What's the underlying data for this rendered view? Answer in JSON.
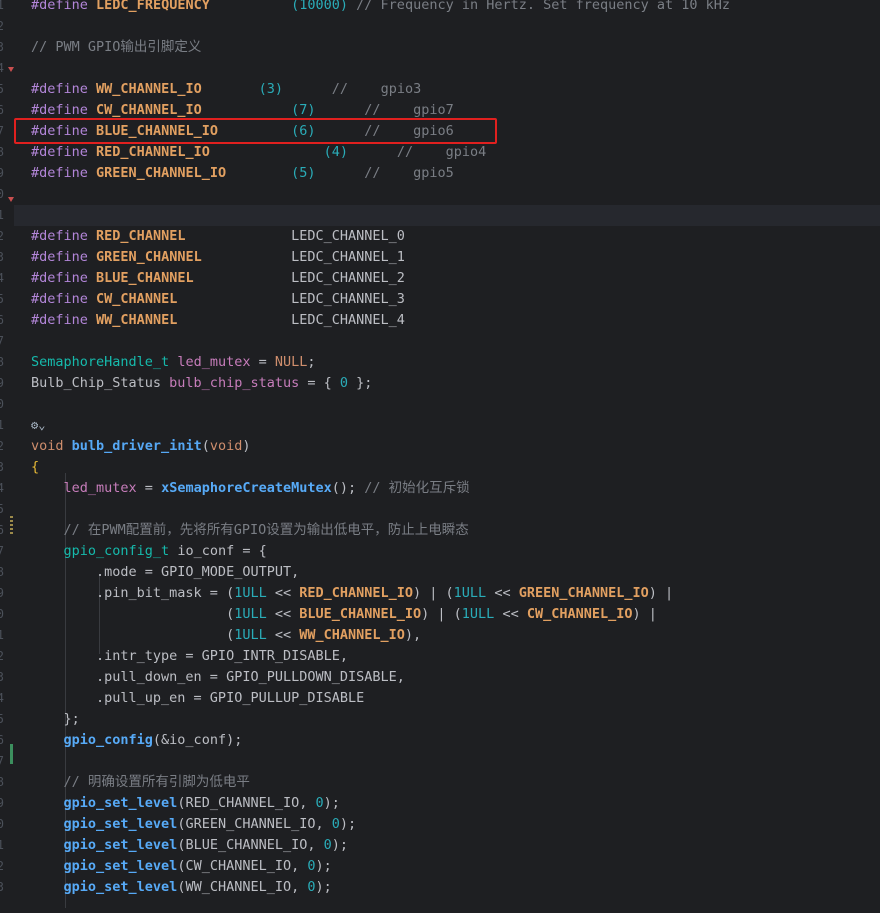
{
  "editor": {
    "gutter_numbers": [
      "",
      "1",
      "2",
      "3",
      "4",
      "5",
      "6",
      "7",
      "8",
      "9",
      "0",
      "1",
      "2",
      "3",
      "4",
      "5",
      "6",
      "7",
      "8",
      "9",
      "0",
      "1",
      "2",
      "3",
      "4",
      "5",
      "6",
      "7",
      "8",
      "9",
      "0",
      "1",
      "2",
      "3",
      "4",
      "5",
      "6",
      "7",
      "8",
      "9",
      "0",
      "1",
      "2",
      "3"
    ],
    "lines": [
      {
        "tokens": [
          [
            "pp",
            "#define"
          ],
          [
            "pl",
            " "
          ],
          [
            "mc",
            "LEDC_FREQUENCY"
          ],
          [
            "pl",
            "          "
          ],
          [
            "num",
            "(10000)"
          ],
          [
            "pl",
            " "
          ],
          [
            "cm",
            "// Frequency in Hertz. Set frequency at 10 kHz"
          ]
        ]
      },
      {
        "tokens": []
      },
      {
        "tokens": [
          [
            "cm",
            "// PWM GPIO输出引脚定义"
          ]
        ]
      },
      {
        "tokens": []
      },
      {
        "tokens": [
          [
            "pp",
            "#define"
          ],
          [
            "pl",
            " "
          ],
          [
            "mc",
            "WW_CHANNEL_IO"
          ],
          [
            "pl",
            "       "
          ],
          [
            "num",
            "(3)"
          ],
          [
            "pl",
            "      "
          ],
          [
            "cm",
            "//    gpio3"
          ]
        ]
      },
      {
        "tokens": [
          [
            "pp",
            "#define"
          ],
          [
            "pl",
            " "
          ],
          [
            "mc",
            "CW_CHANNEL_IO"
          ],
          [
            "pl",
            "           "
          ],
          [
            "num",
            "(7)"
          ],
          [
            "pl",
            "      "
          ],
          [
            "cm",
            "//    gpio7"
          ]
        ]
      },
      {
        "tokens": [
          [
            "pp",
            "#define"
          ],
          [
            "pl",
            " "
          ],
          [
            "mc",
            "BLUE_CHANNEL_IO"
          ],
          [
            "pl",
            "         "
          ],
          [
            "num",
            "(6)"
          ],
          [
            "pl",
            "      "
          ],
          [
            "cm",
            "//    gpio6"
          ]
        ]
      },
      {
        "tokens": [
          [
            "pp",
            "#define"
          ],
          [
            "pl",
            " "
          ],
          [
            "mc",
            "RED_CHANNEL_IO"
          ],
          [
            "pl",
            "              "
          ],
          [
            "num",
            "(4)"
          ],
          [
            "pl",
            "      "
          ],
          [
            "cm",
            "//    gpio4"
          ]
        ]
      },
      {
        "tokens": [
          [
            "pp",
            "#define"
          ],
          [
            "pl",
            " "
          ],
          [
            "mc",
            "GREEN_CHANNEL_IO"
          ],
          [
            "pl",
            "        "
          ],
          [
            "num",
            "(5)"
          ],
          [
            "pl",
            "      "
          ],
          [
            "cm",
            "//    gpio5"
          ]
        ]
      },
      {
        "tokens": []
      },
      {
        "tokens": []
      },
      {
        "tokens": [
          [
            "pp",
            "#define"
          ],
          [
            "pl",
            " "
          ],
          [
            "mc",
            "RED_CHANNEL"
          ],
          [
            "pl",
            "             "
          ],
          [
            "pl",
            "LEDC_CHANNEL_0"
          ]
        ]
      },
      {
        "tokens": [
          [
            "pp",
            "#define"
          ],
          [
            "pl",
            " "
          ],
          [
            "mc",
            "GREEN_CHANNEL"
          ],
          [
            "pl",
            "           "
          ],
          [
            "pl",
            "LEDC_CHANNEL_1"
          ]
        ]
      },
      {
        "tokens": [
          [
            "pp",
            "#define"
          ],
          [
            "pl",
            " "
          ],
          [
            "mc",
            "BLUE_CHANNEL"
          ],
          [
            "pl",
            "            "
          ],
          [
            "pl",
            "LEDC_CHANNEL_2"
          ]
        ]
      },
      {
        "tokens": [
          [
            "pp",
            "#define"
          ],
          [
            "pl",
            " "
          ],
          [
            "mc",
            "CW_CHANNEL"
          ],
          [
            "pl",
            "              "
          ],
          [
            "pl",
            "LEDC_CHANNEL_3"
          ]
        ]
      },
      {
        "tokens": [
          [
            "pp",
            "#define"
          ],
          [
            "pl",
            " "
          ],
          [
            "mc",
            "WW_CHANNEL"
          ],
          [
            "pl",
            "              "
          ],
          [
            "pl",
            "LEDC_CHANNEL_4"
          ]
        ]
      },
      {
        "tokens": []
      },
      {
        "tokens": [
          [
            "ty",
            "SemaphoreHandle_t"
          ],
          [
            "pl",
            " "
          ],
          [
            "gv",
            "led_mutex"
          ],
          [
            "pl",
            " = "
          ],
          [
            "kw",
            "NULL"
          ],
          [
            "pl",
            ";"
          ]
        ]
      },
      {
        "tokens": [
          [
            "pl",
            "Bulb_Chip_Status "
          ],
          [
            "gv",
            "bulb_chip_status"
          ],
          [
            "pl",
            " = { "
          ],
          [
            "num",
            "0"
          ],
          [
            "pl",
            " };"
          ]
        ]
      },
      {
        "tokens": []
      },
      {
        "tokens": [
          [
            "hint-icon",
            "⚙⌄"
          ]
        ]
      },
      {
        "tokens": [
          [
            "kw",
            "void"
          ],
          [
            "pl",
            " "
          ],
          [
            "fn",
            "bulb_driver_init"
          ],
          [
            "pl",
            "("
          ],
          [
            "kw",
            "void"
          ],
          [
            "pl",
            ")"
          ]
        ]
      },
      {
        "tokens": [
          [
            "br",
            "{"
          ]
        ]
      },
      {
        "tokens": [
          [
            "pl",
            "    "
          ],
          [
            "gv",
            "led_mutex"
          ],
          [
            "pl",
            " = "
          ],
          [
            "fc",
            "xSemaphoreCreateMutex"
          ],
          [
            "pl",
            "(); "
          ],
          [
            "cm",
            "// 初始化互斥锁"
          ]
        ]
      },
      {
        "tokens": []
      },
      {
        "tokens": [
          [
            "pl",
            "    "
          ],
          [
            "cm",
            "// 在PWM配置前，先将所有GPIO设置为输出低电平，防止上电瞬态"
          ]
        ]
      },
      {
        "tokens": [
          [
            "pl",
            "    "
          ],
          [
            "ty",
            "gpio_config_t"
          ],
          [
            "pl",
            " io_conf = {"
          ]
        ]
      },
      {
        "tokens": [
          [
            "pl",
            "        .mode = GPIO_MODE_OUTPUT,"
          ]
        ]
      },
      {
        "tokens": [
          [
            "pl",
            "        .pin_bit_mask = ("
          ],
          [
            "num",
            "1ULL"
          ],
          [
            "pl",
            " << "
          ],
          [
            "mc",
            "RED_CHANNEL_IO"
          ],
          [
            "pl",
            ") | ("
          ],
          [
            "num",
            "1ULL"
          ],
          [
            "pl",
            " << "
          ],
          [
            "mc",
            "GREEN_CHANNEL_IO"
          ],
          [
            "pl",
            ") |"
          ]
        ]
      },
      {
        "tokens": [
          [
            "pl",
            "                        ("
          ],
          [
            "num",
            "1ULL"
          ],
          [
            "pl",
            " << "
          ],
          [
            "mc",
            "BLUE_CHANNEL_IO"
          ],
          [
            "pl",
            ") | ("
          ],
          [
            "num",
            "1ULL"
          ],
          [
            "pl",
            " << "
          ],
          [
            "mc",
            "CW_CHANNEL_IO"
          ],
          [
            "pl",
            ") |"
          ]
        ]
      },
      {
        "tokens": [
          [
            "pl",
            "                        ("
          ],
          [
            "num",
            "1ULL"
          ],
          [
            "pl",
            " << "
          ],
          [
            "mc",
            "WW_CHANNEL_IO"
          ],
          [
            "pl",
            "),"
          ]
        ]
      },
      {
        "tokens": [
          [
            "pl",
            "        .intr_type = GPIO_INTR_DISABLE,"
          ]
        ]
      },
      {
        "tokens": [
          [
            "pl",
            "        .pull_down_en = GPIO_PULLDOWN_DISABLE,"
          ]
        ]
      },
      {
        "tokens": [
          [
            "pl",
            "        .pull_up_en = GPIO_PULLUP_DISABLE"
          ]
        ]
      },
      {
        "tokens": [
          [
            "pl",
            "    };"
          ]
        ]
      },
      {
        "tokens": [
          [
            "pl",
            "    "
          ],
          [
            "fc",
            "gpio_config"
          ],
          [
            "pl",
            "(&io_conf);"
          ]
        ]
      },
      {
        "tokens": []
      },
      {
        "tokens": [
          [
            "pl",
            "    "
          ],
          [
            "cm",
            "// 明确设置所有引脚为低电平"
          ]
        ]
      },
      {
        "tokens": [
          [
            "pl",
            "    "
          ],
          [
            "fc",
            "gpio_set_level"
          ],
          [
            "pl",
            "(RED_CHANNEL_IO, "
          ],
          [
            "num",
            "0"
          ],
          [
            "pl",
            ");"
          ]
        ]
      },
      {
        "tokens": [
          [
            "pl",
            "    "
          ],
          [
            "fc",
            "gpio_set_level"
          ],
          [
            "pl",
            "(GREEN_CHANNEL_IO, "
          ],
          [
            "num",
            "0"
          ],
          [
            "pl",
            ");"
          ]
        ]
      },
      {
        "tokens": [
          [
            "pl",
            "    "
          ],
          [
            "fc",
            "gpio_set_level"
          ],
          [
            "pl",
            "(BLUE_CHANNEL_IO, "
          ],
          [
            "num",
            "0"
          ],
          [
            "pl",
            ");"
          ]
        ]
      },
      {
        "tokens": [
          [
            "pl",
            "    "
          ],
          [
            "fc",
            "gpio_set_level"
          ],
          [
            "pl",
            "(CW_CHANNEL_IO, "
          ],
          [
            "num",
            "0"
          ],
          [
            "pl",
            ");"
          ]
        ]
      },
      {
        "tokens": [
          [
            "pl",
            "    "
          ],
          [
            "fc",
            "gpio_set_level"
          ],
          [
            "pl",
            "(WW_CHANNEL_IO, "
          ],
          [
            "num",
            "0"
          ],
          [
            "pl",
            ");"
          ]
        ]
      }
    ],
    "highlight_line_index": 6,
    "current_line_index": 10,
    "colors": {
      "background": "#1e1f22",
      "highlight_box": "#e0201f",
      "macro": "#e2a061",
      "preprocessor": "#b386d9",
      "comment": "#7a7e85",
      "number": "#2aacb8"
    }
  }
}
